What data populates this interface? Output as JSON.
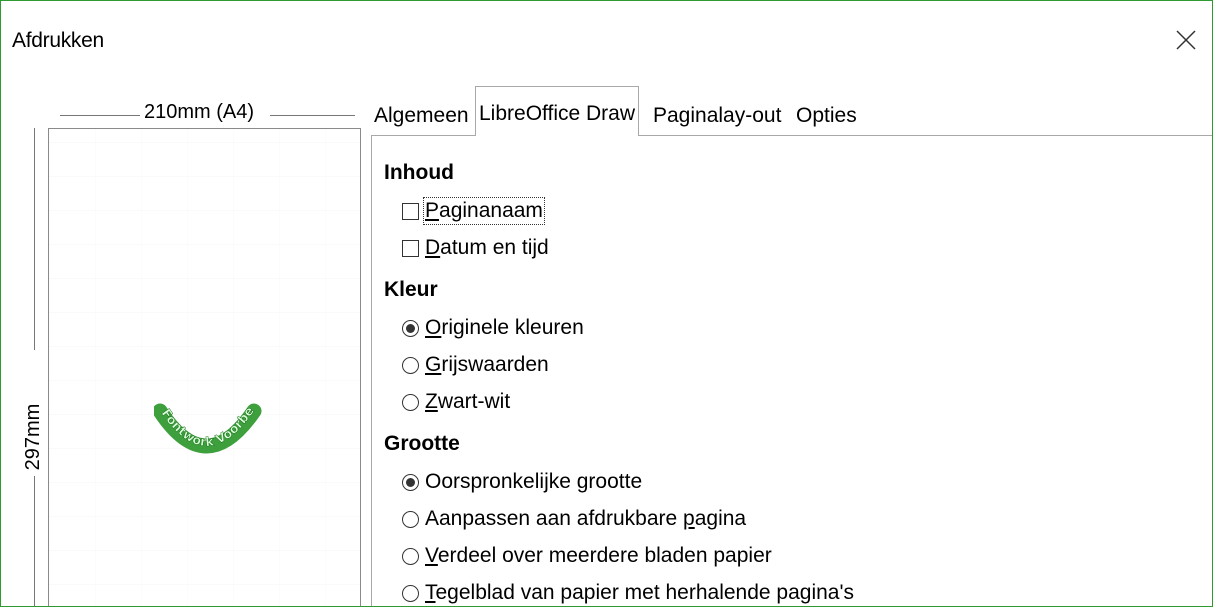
{
  "window": {
    "title": "Afdrukken"
  },
  "preview": {
    "width_label": "210mm (A4)",
    "height_label": "297mm",
    "graphic_text": "Fontwork Voorbeeld"
  },
  "tabs": [
    {
      "label": "Algemeen",
      "active": false
    },
    {
      "label": "LibreOffice Draw",
      "active": true
    },
    {
      "label": "Paginalay-out",
      "active": false
    },
    {
      "label": "Opties",
      "active": false
    }
  ],
  "panel": {
    "inhoud": {
      "title": "Inhoud",
      "options": [
        {
          "pre": "",
          "mn": "P",
          "post": "aginanaam",
          "checked": false
        },
        {
          "pre": "",
          "mn": "D",
          "post": "atum en tijd",
          "checked": false
        }
      ]
    },
    "kleur": {
      "title": "Kleur",
      "options": [
        {
          "pre": "",
          "mn": "O",
          "post": "riginele kleuren",
          "checked": true
        },
        {
          "pre": "",
          "mn": "G",
          "post": "rijswaarden",
          "checked": false
        },
        {
          "pre": "",
          "mn": "Z",
          "post": "wart-wit",
          "checked": false
        }
      ]
    },
    "grootte": {
      "title": "Grootte",
      "options": [
        {
          "pre": "Oorspronkeli",
          "mn": "j",
          "post": "ke grootte",
          "checked": true
        },
        {
          "pre": "Aanpassen aan afdrukbare ",
          "mn": "p",
          "post": "agina",
          "checked": false
        },
        {
          "pre": "",
          "mn": "V",
          "post": "erdeel over meerdere bladen papier",
          "checked": false
        },
        {
          "pre": "",
          "mn": "T",
          "post": "egelblad van papier met herhalende pagina's",
          "checked": false
        }
      ]
    }
  }
}
